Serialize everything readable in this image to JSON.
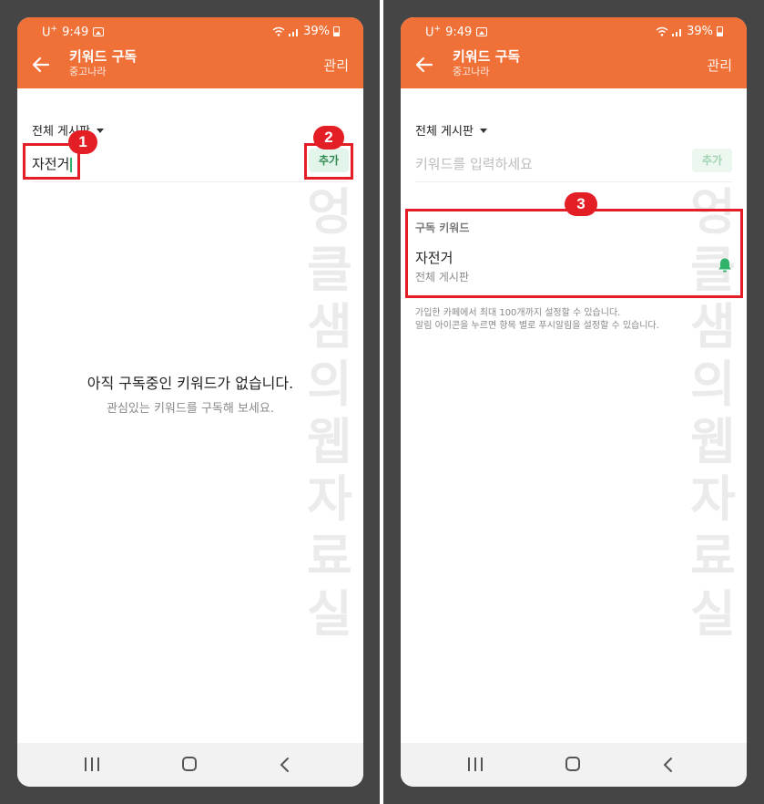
{
  "status_bar": {
    "carrier": "U",
    "carrier_sup": "+",
    "time": "9:49",
    "battery": "39%"
  },
  "header": {
    "title": "키워드 구독",
    "subtitle": "중고나라",
    "manage_label": "관리"
  },
  "board_select": {
    "label": "전체 게시판"
  },
  "screen1": {
    "input_value": "자전거",
    "add_label": "추가",
    "empty_title": "아직 구독중인 키워드가 없습니다.",
    "empty_subtitle": "관심있는 키워드를 구독해 보세요."
  },
  "screen2": {
    "input_placeholder": "키워드를 입력하세요",
    "add_label": "추가",
    "subscribed_section_label": "구독 키워드",
    "subscribed": [
      {
        "keyword": "자전거",
        "board": "전체 게시판"
      }
    ],
    "info_lines": [
      "가입한 카페에서 최대 100개까지 설정할 수 있습니다.",
      "알림 아이콘을 누르면 항목 별로 푸시알림을 설정할 수 있습니다."
    ]
  },
  "watermark": "엉클샘의웹자료실",
  "callouts": [
    "1",
    "2",
    "3"
  ],
  "colors": {
    "header_bg": "#f07138",
    "accent_green": "#2fb36a",
    "callout_red": "#e31e24"
  },
  "icons": [
    "back-arrow-icon",
    "gallery-icon",
    "wifi-icon",
    "signal-icon",
    "battery-icon",
    "caret-down-icon",
    "bell-icon",
    "recents-icon",
    "home-icon",
    "nav-back-icon"
  ]
}
